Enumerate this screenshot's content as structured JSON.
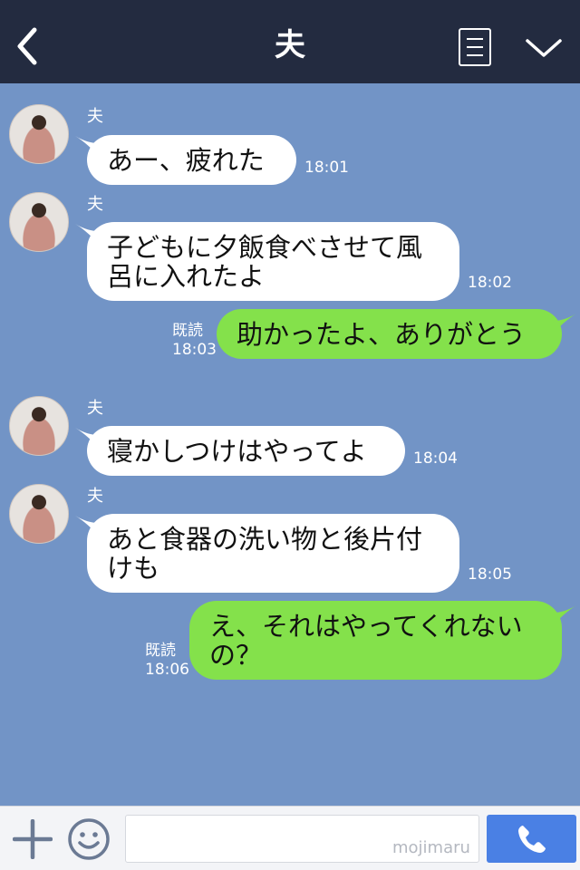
{
  "header": {
    "title": "夫",
    "back_icon": "chevron-left-icon",
    "menu_icon": "menu-list-icon",
    "collapse_icon": "chevron-down-icon"
  },
  "messages": [
    {
      "direction": "in",
      "sender": "夫",
      "text": "あー、疲れた",
      "time": "18:01"
    },
    {
      "direction": "in",
      "sender": "夫",
      "text": "子どもに夕飯食べさせて風\n呂に入れたよ",
      "time": "18:02"
    },
    {
      "direction": "out",
      "read": "既読",
      "text": "助かったよ、ありがとう",
      "time": "18:03"
    },
    {
      "direction": "in",
      "sender": "夫",
      "text": "寝かしつけはやってよ",
      "time": "18:04"
    },
    {
      "direction": "in",
      "sender": "夫",
      "text": "あと食器の洗い物と後片付\nけも",
      "time": "18:05"
    },
    {
      "direction": "out",
      "read": "既読",
      "text": "え、それはやってくれない\nの？",
      "time": "18:06"
    }
  ],
  "input_bar": {
    "plus_icon": "plus-icon",
    "sticker_icon": "smiley-face-icon",
    "input_value": "",
    "watermark": "mojimaru",
    "call_icon": "phone-icon"
  },
  "colors": {
    "header_bg": "#232b40",
    "chat_bg": "#7294c6",
    "incoming_bubble": "#ffffff",
    "outgoing_bubble": "#84e14b",
    "call_button": "#4a80e4"
  }
}
